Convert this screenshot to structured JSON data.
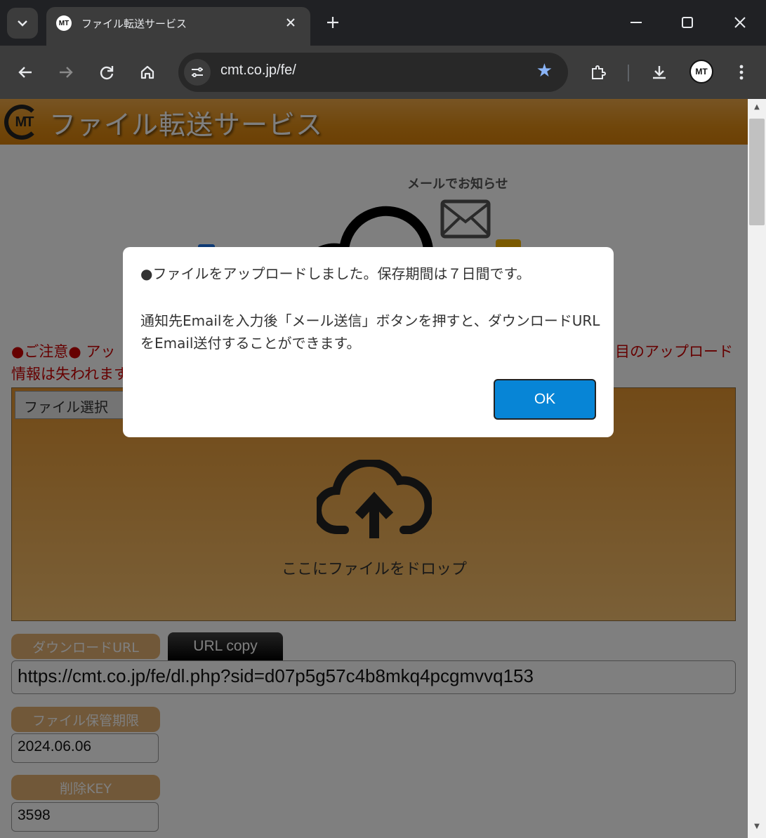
{
  "browser": {
    "tab_title": "ファイル転送サービス",
    "favicon_text": "MT",
    "url": "cmt.co.jp/fe/",
    "profile_text": "MT"
  },
  "page": {
    "logo_text": "MT",
    "site_title": "ファイル転送サービス",
    "hero_label": "メールでお知らせ",
    "notice_start": "●ご注意● アッ",
    "notice_tail": "目のアップロード",
    "notice_line2": "情報は失われます",
    "file_select_label": "ファイル選択",
    "drop_text": "ここにファイルをドロップ",
    "download_url_label": "ダウンロードURL",
    "url_copy_label": "URL copy",
    "download_url": "https://cmt.co.jp/fe/dl.php?sid=d07p5g57c4b8mkq4pcgmvvq153",
    "expiry_label": "ファイル保管期限",
    "expiry_value": "2024.06.06",
    "delete_key_label": "削除KEY",
    "delete_key_value": "3598"
  },
  "dialog": {
    "line1": "●ファイルをアップロードしました。保存期間は７日間です。",
    "line2": "通知先Emailを入力後「メール送信」ボタンを押すと、ダウンロードURLをEmail送付することができます。",
    "ok_label": "OK"
  },
  "colors": {
    "header": "#e08d16",
    "ok_button": "#0785d6",
    "notice": "#cc0000"
  }
}
